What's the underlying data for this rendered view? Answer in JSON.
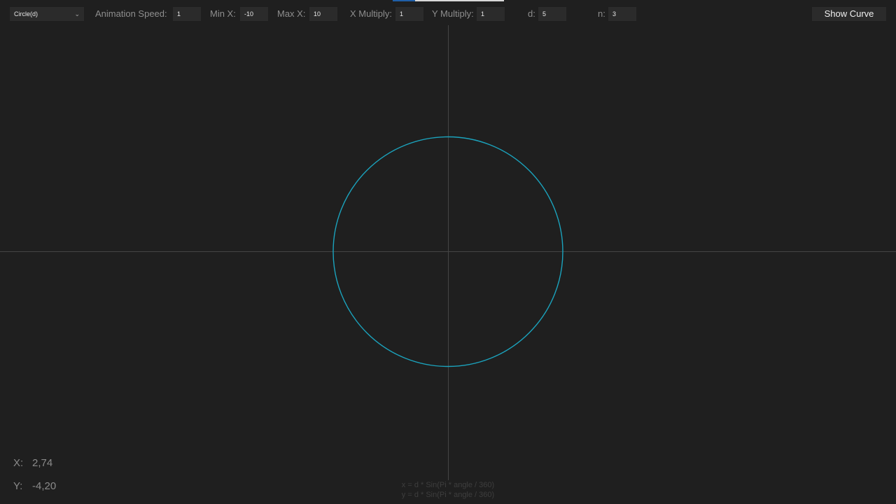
{
  "toolbar": {
    "curve_select": {
      "value": "Circle(d)",
      "icon": "chevron-down-icon"
    },
    "animation_speed": {
      "label": "Animation Speed:",
      "value": "1"
    },
    "min_x": {
      "label": "Min X:",
      "value": "-10"
    },
    "max_x": {
      "label": "Max X:",
      "value": "10"
    },
    "x_multiply": {
      "label": "X Multiply:",
      "value": "1"
    },
    "y_multiply": {
      "label": "Y Multiply:",
      "value": "1"
    },
    "d": {
      "label": "d:",
      "value": "5"
    },
    "n": {
      "label": "n:",
      "value": "3"
    },
    "show_curve_label": "Show Curve"
  },
  "progress": {
    "fraction": 0.2
  },
  "readout": {
    "x_label": "X:",
    "x_value": "2,74",
    "y_label": "Y:",
    "y_value": "-4,20"
  },
  "formula": {
    "line1": "x = d * Sin(Pi * angle / 360)",
    "line2": "y = d * Sin(Pi * angle / 360)"
  },
  "colors": {
    "background": "#1f1f1f",
    "curve": "#1ba3bd",
    "axes": "#444444",
    "progress": "#1f5fa8"
  }
}
